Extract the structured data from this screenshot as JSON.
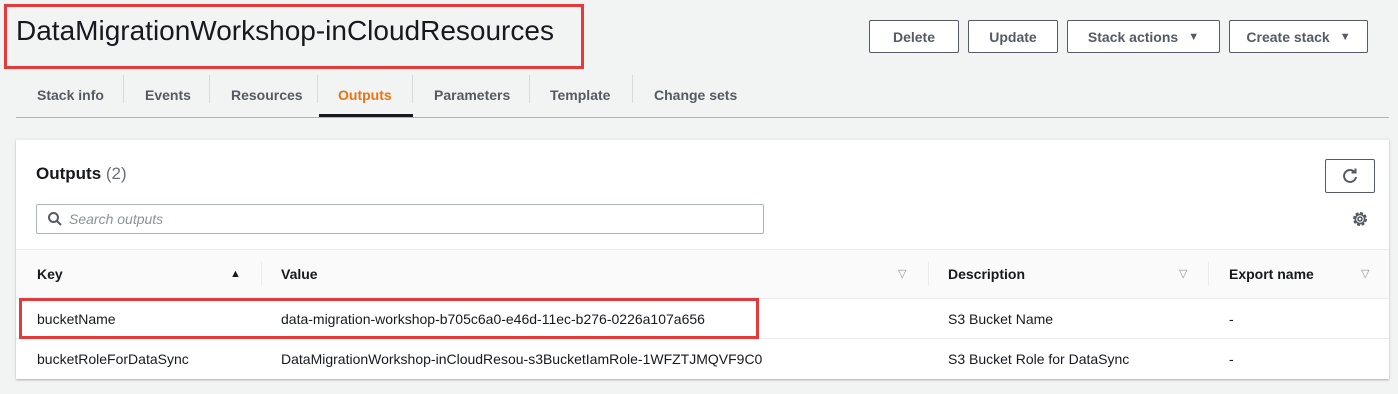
{
  "stack": {
    "title": "DataMigrationWorkshop-inCloudResources"
  },
  "actions": {
    "delete_label": "Delete",
    "update_label": "Update",
    "stack_actions_label": "Stack actions",
    "create_stack_label": "Create stack"
  },
  "tabs": [
    {
      "label": "Stack info"
    },
    {
      "label": "Events"
    },
    {
      "label": "Resources"
    },
    {
      "label": "Outputs",
      "active": true
    },
    {
      "label": "Parameters"
    },
    {
      "label": "Template"
    },
    {
      "label": "Change sets"
    }
  ],
  "outputs": {
    "title": "Outputs",
    "count": "(2)",
    "search_placeholder": "Search outputs",
    "columns": {
      "key": "Key",
      "value": "Value",
      "description": "Description",
      "export_name": "Export name"
    },
    "rows": [
      {
        "key": "bucketName",
        "value": "data-migration-workshop-b705c6a0-e46d-11ec-b276-0226a107a656",
        "description": "S3 Bucket Name",
        "export_name": "-"
      },
      {
        "key": "bucketRoleForDataSync",
        "value": "DataMigrationWorkshop-inCloudResou-s3BucketIamRole-1WFZTJMQVF9C0",
        "description": "S3 Bucket Role for DataSync",
        "export_name": "-"
      }
    ]
  },
  "colors": {
    "accent_active_tab": "#ec7211",
    "highlight_box": "#e5393a"
  },
  "icons": {
    "refresh": "refresh-icon",
    "settings": "gear-icon",
    "search": "search-icon",
    "sort": "sort-ascending-icon",
    "filter": "filter-caret-icon",
    "dropdown": "caret-down-icon"
  }
}
